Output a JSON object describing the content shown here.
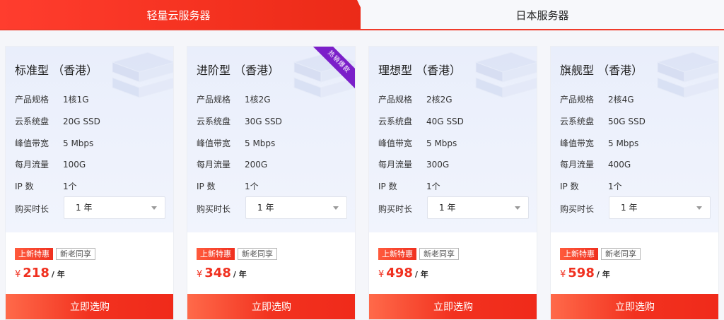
{
  "tabs": [
    {
      "label": "轻量云服务器",
      "active": true
    },
    {
      "label": "日本服务器",
      "active": false
    }
  ],
  "colors": {
    "accent": "#f0301f",
    "ribbon": "#7b1fc9",
    "card_top": "#eaeffb"
  },
  "spec_labels": {
    "spec": "产品规格",
    "disk": "云系统盘",
    "bandwidth": "峰值带宽",
    "traffic": "每月流量",
    "ip": "IP 数",
    "duration": "购买时长"
  },
  "cards": [
    {
      "title": "标准型 （香港）",
      "spec": "1核1G",
      "disk": "20G SSD",
      "bandwidth": "5 Mbps",
      "traffic": "100G",
      "ip": "1个",
      "duration": "1 年",
      "badge_new": "上新特惠",
      "badge_share": "新老同享",
      "currency": "¥",
      "price": "218",
      "unit": "/ 年",
      "button": "立即选购"
    },
    {
      "title": "进阶型 （香港）",
      "spec": "1核2G",
      "disk": "30G SSD",
      "bandwidth": "5 Mbps",
      "traffic": "200G",
      "ip": "1个",
      "duration": "1 年",
      "badge_new": "上新特惠",
      "badge_share": "新老同享",
      "currency": "¥",
      "price": "348",
      "unit": "/ 年",
      "button": "立即选购",
      "ribbon": "热销爆款"
    },
    {
      "title": "理想型 （香港）",
      "spec": "2核2G",
      "disk": "40G SSD",
      "bandwidth": "5 Mbps",
      "traffic": "300G",
      "ip": "1个",
      "duration": "1 年",
      "badge_new": "上新特惠",
      "badge_share": "新老同享",
      "currency": "¥",
      "price": "498",
      "unit": "/ 年",
      "button": "立即选购"
    },
    {
      "title": "旗舰型 （香港）",
      "spec": "2核4G",
      "disk": "50G SSD",
      "bandwidth": "5 Mbps",
      "traffic": "400G",
      "ip": "1个",
      "duration": "1 年",
      "badge_new": "上新特惠",
      "badge_share": "新老同享",
      "currency": "¥",
      "price": "598",
      "unit": "/ 年",
      "button": "立即选购"
    }
  ]
}
